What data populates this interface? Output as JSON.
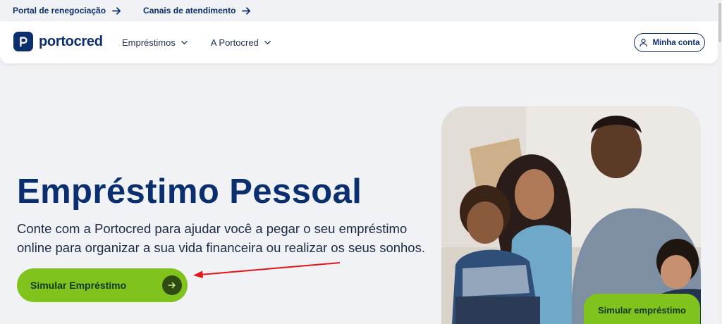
{
  "topbar": {
    "links": [
      {
        "label": "Portal de renegociação"
      },
      {
        "label": "Canais de atendimento"
      }
    ]
  },
  "header": {
    "brand": "portocred",
    "nav": [
      {
        "label": "Empréstimos"
      },
      {
        "label": "A Portocred"
      }
    ],
    "account_label": "Minha conta"
  },
  "hero": {
    "title": "Empréstimo Pessoal",
    "subtitle": "Conte com a Portocred para ajudar você a pegar o seu empréstimo online para organizar a sua vida financeira ou realizar os seus sonhos.",
    "cta_label": "Simular Empréstimo"
  },
  "photo": {
    "cta_label": "Simular empréstimo"
  },
  "colors": {
    "brand_navy": "#0b2e6f",
    "accent_green": "#7fc31c",
    "background": "#f0f2f5",
    "annotation_red": "#e01818"
  },
  "icons": [
    "arrow-right-icon",
    "chevron-down-icon",
    "user-icon",
    "logo-icon"
  ]
}
